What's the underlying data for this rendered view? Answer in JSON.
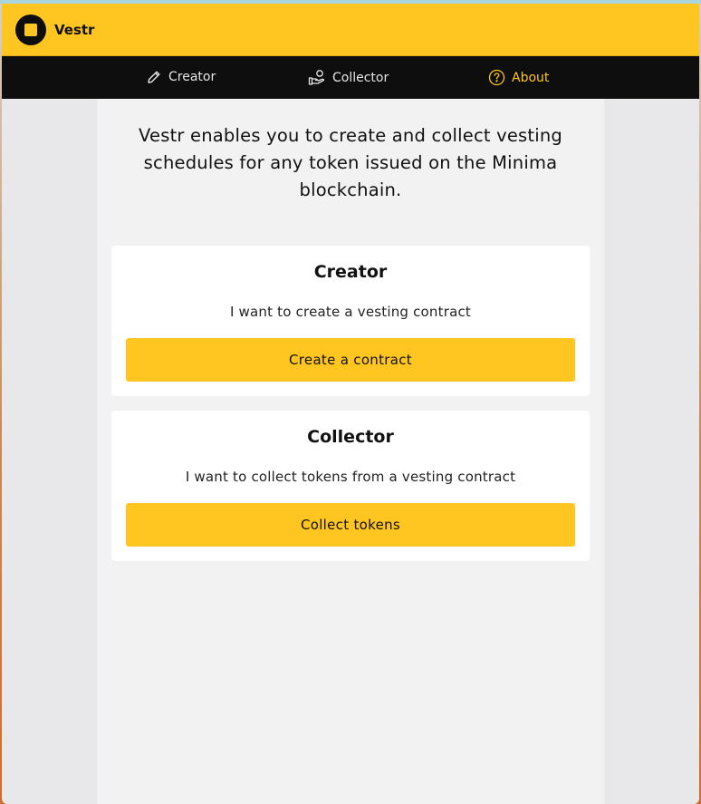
{
  "app": {
    "title": "Vestr"
  },
  "nav": {
    "items": [
      {
        "label": "Creator",
        "icon": "pencil-icon"
      },
      {
        "label": "Collector",
        "icon": "hand-coin-icon"
      },
      {
        "label": "About",
        "icon": "help-circle-icon"
      }
    ],
    "active": "About"
  },
  "main": {
    "intro": "Vestr enables you to create and collect vesting schedules for any token issued on the Minima blockchain.",
    "cards": [
      {
        "title": "Creator",
        "description": "I want to create a vesting contract",
        "button": "Create a contract"
      },
      {
        "title": "Collector",
        "description": "I want to collect tokens from a vesting contract",
        "button": "Collect tokens"
      }
    ]
  },
  "colors": {
    "accent": "#ffc520",
    "nav_bg": "#0e0e0f",
    "page_bg": "#f2f2f2",
    "card_bg": "#ffffff"
  }
}
